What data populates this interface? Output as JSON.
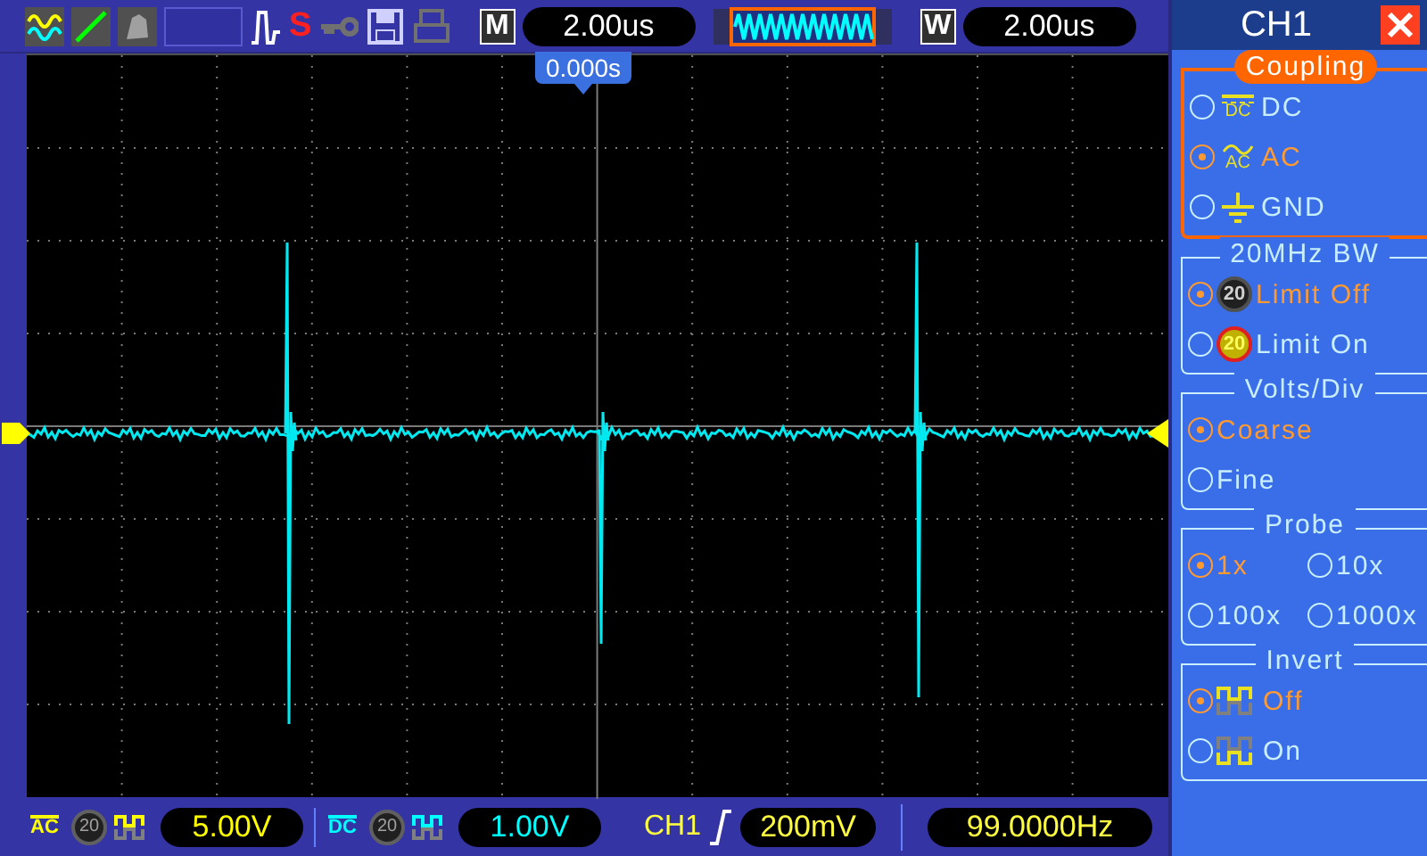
{
  "toolbar": {
    "icons": [
      {
        "kind": "dual-wave",
        "selected": false
      },
      {
        "kind": "line",
        "selected": false
      },
      {
        "kind": "persist",
        "selected": false
      },
      {
        "kind": "blank",
        "selected": false
      },
      {
        "kind": "pulse",
        "selected": false
      },
      {
        "kind": "s-letter",
        "text": "S",
        "selected": false
      },
      {
        "kind": "key",
        "selected": false
      },
      {
        "kind": "floppy",
        "selected": false
      },
      {
        "kind": "printer",
        "selected": false
      }
    ],
    "timebase": {
      "label": "M",
      "value": "2.00us"
    },
    "window": {
      "label": "W",
      "value": "2.00us"
    }
  },
  "screen": {
    "trigger_time": "0.000s"
  },
  "status_bar": {
    "channels": [
      {
        "coupling_icon": "AC",
        "bw_icon": "20",
        "scale": "5.00V",
        "color": "#ffff00"
      },
      {
        "coupling_icon": "DC",
        "bw_icon": "20",
        "scale": "1.00V",
        "color": "#00ffff"
      }
    ],
    "trigger": {
      "source": "CH1",
      "level": "200mV"
    },
    "frequency": "99.0000Hz"
  },
  "menu": {
    "title": "CH1",
    "sections": [
      {
        "title": "Coupling",
        "highlighted": true,
        "options": [
          {
            "label": "DC",
            "kind": "dc",
            "icon_text": "DC",
            "selected": false
          },
          {
            "label": "AC",
            "kind": "ac",
            "icon_text": "AC",
            "selected": true
          },
          {
            "label": "GND",
            "kind": "gnd",
            "selected": false
          }
        ]
      },
      {
        "title": "20MHz BW",
        "highlighted": false,
        "options": [
          {
            "label": "Limit Off",
            "kind": "bw-off",
            "icon_text": "20",
            "selected": true
          },
          {
            "label": "Limit On",
            "kind": "bw-on",
            "icon_text": "20",
            "selected": false
          }
        ]
      },
      {
        "title": "Volts/Div",
        "highlighted": false,
        "options": [
          {
            "label": "Coarse",
            "kind": "plain",
            "selected": true
          },
          {
            "label": "Fine",
            "kind": "plain",
            "selected": false
          }
        ]
      },
      {
        "title": "Probe",
        "highlighted": false,
        "options": [
          {
            "label": "1x",
            "kind": "plain",
            "selected": true
          },
          {
            "label": "10x",
            "kind": "plain",
            "selected": false
          },
          {
            "label": "100x",
            "kind": "plain",
            "selected": false
          },
          {
            "label": "1000x",
            "kind": "plain",
            "selected": false
          }
        ]
      },
      {
        "title": "Invert",
        "highlighted": false,
        "options": [
          {
            "label": "Off",
            "kind": "inv-off",
            "selected": true
          },
          {
            "label": "On",
            "kind": "inv-on",
            "selected": false
          }
        ]
      }
    ]
  }
}
